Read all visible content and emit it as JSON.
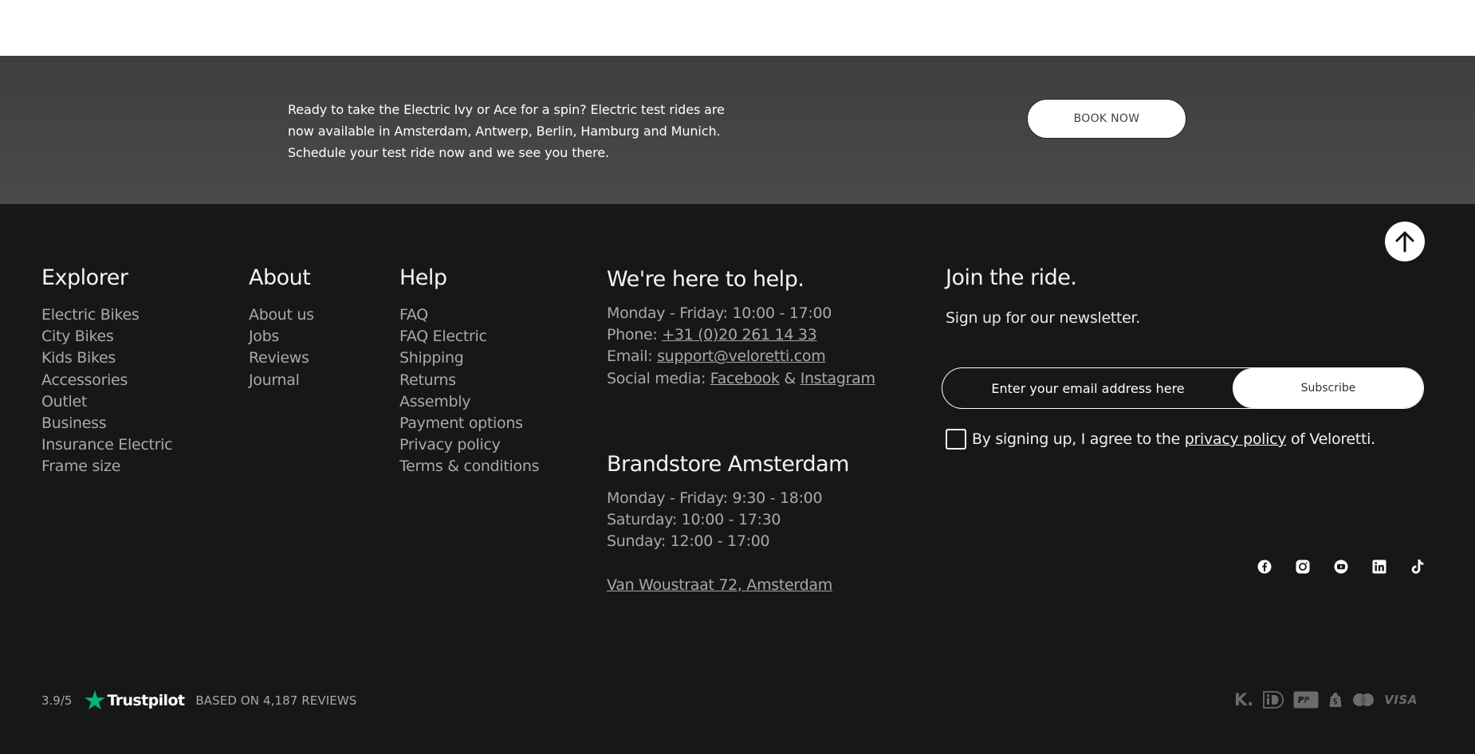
{
  "banner": {
    "text": "Ready to take the Electric Ivy or Ace for a spin? Electric test rides are now available in Amsterdam, Antwerp, Berlin, Hamburg and Munich. Schedule your test ride now and we see you there.",
    "button_label": "BOOK NOW"
  },
  "explorer": {
    "title": "Explorer",
    "items": [
      "Electric Bikes",
      "City Bikes",
      "Kids Bikes",
      "Accessories",
      "Outlet",
      "Business",
      "Insurance Electric",
      "Frame size"
    ]
  },
  "about": {
    "title": "About",
    "items": [
      "About us",
      "Jobs",
      "Reviews",
      "Journal"
    ]
  },
  "help_links": {
    "title": "Help",
    "items": [
      "FAQ",
      "FAQ Electric",
      "Shipping",
      "Returns",
      "Assembly",
      "Payment options",
      "Privacy policy",
      "Terms & conditions"
    ]
  },
  "contact": {
    "title": "We're here to help.",
    "hours": "Monday - Friday: 10:00 - 17:00",
    "phone_label": "Phone: ",
    "phone": "+31 (0)20 261 14 33",
    "email_label": "Email: ",
    "email": "support@veloretti.com",
    "social_label": "Social media: ",
    "facebook": "Facebook",
    "and": " & ",
    "instagram": "Instagram"
  },
  "store": {
    "title": "Brandstore Amsterdam",
    "weekdays": "Monday - Friday: 9:30 - 18:00",
    "saturday": "Saturday: 10:00 - 17:30",
    "sunday": "Sunday: 12:00 - 17:00",
    "address": "Van Woustraat 72, Amsterdam"
  },
  "newsletter": {
    "title": "Join the ride.",
    "subtitle": "Sign up for our newsletter.",
    "placeholder": "Enter your email address here",
    "button_label": "Subscribe",
    "consent_prefix": "By signing up, I agree to the ",
    "consent_link": "privacy policy",
    "consent_suffix": " of Veloretti."
  },
  "trustpilot": {
    "score": "3.9/5",
    "brand": "Trustpilot",
    "based_on": "BASED ON 4,187 REVIEWS"
  },
  "icons": {
    "social": [
      "facebook-icon",
      "instagram-icon",
      "youtube-icon",
      "linkedin-icon",
      "tiktok-icon"
    ],
    "payments": [
      "klarna-icon",
      "ideal-icon",
      "paypal-icon",
      "shopify-pay-icon",
      "mastercard-icon",
      "visa-icon"
    ]
  },
  "payment_labels": {
    "klarna": "K.",
    "visa": "VISA"
  },
  "colors": {
    "footer_bg": "#161718",
    "banner_bg": "#454547",
    "link_gray": "#a9a9ab",
    "trustpilot_green": "#00b67a"
  }
}
